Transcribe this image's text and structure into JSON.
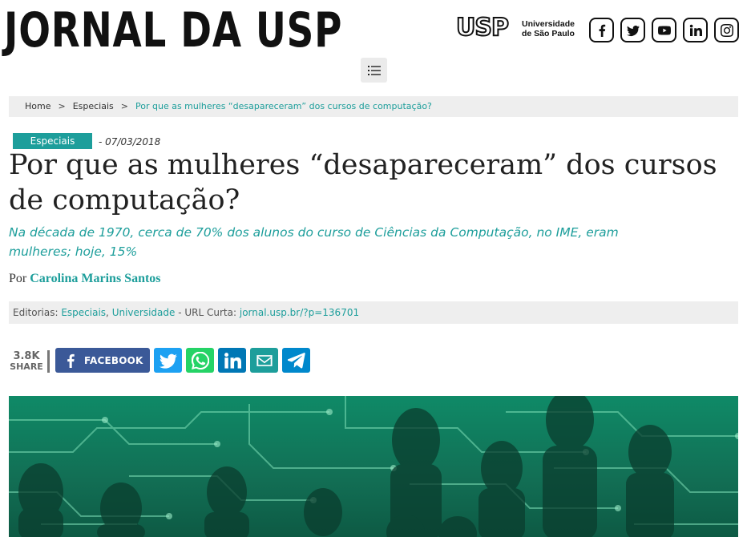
{
  "site": {
    "masthead": "JORNAL DA USP"
  },
  "usp_logo": {
    "mark": "USP",
    "line1": "Universidade",
    "line2": "de São Paulo"
  },
  "social_icons": [
    "facebook-icon",
    "twitter-icon",
    "youtube-icon",
    "linkedin-icon",
    "instagram-icon"
  ],
  "breadcrumb": {
    "home": "Home",
    "separator": ">",
    "section": "Especiais",
    "current": "Por que as mulheres “desapareceram” dos cursos de computação?"
  },
  "article": {
    "category": "Especiais",
    "date": "- 07/03/2018",
    "title": "Por que as mulheres “desapareceram” dos cursos de computação?",
    "subtitle": "Na década de 1970, cerca de 70% dos alunos do curso de Ciências da Computação, no IME, eram mulheres; hoje, 15%",
    "byline_prefix": "Por",
    "author": "Carolina Marins Santos"
  },
  "editorias": {
    "label": "Editorias:",
    "items": [
      "Especiais",
      "Universidade"
    ],
    "comma": ",",
    "url_label": "- URL Curta:",
    "url": "jornal.usp.br/?p=136701"
  },
  "share": {
    "count": "3.8K",
    "label": "SHARE",
    "facebook_label": "FACEBOOK",
    "buttons": [
      "twitter-icon",
      "whatsapp-icon",
      "linkedin-icon",
      "email-icon",
      "telegram-icon"
    ]
  },
  "colors": {
    "accent": "#1d9e9b",
    "facebook": "#3b5998",
    "twitter": "#1da1f2",
    "whatsapp": "#25d366",
    "linkedin": "#0077b5",
    "email": "#1d9e9b",
    "telegram": "#0088cc"
  }
}
